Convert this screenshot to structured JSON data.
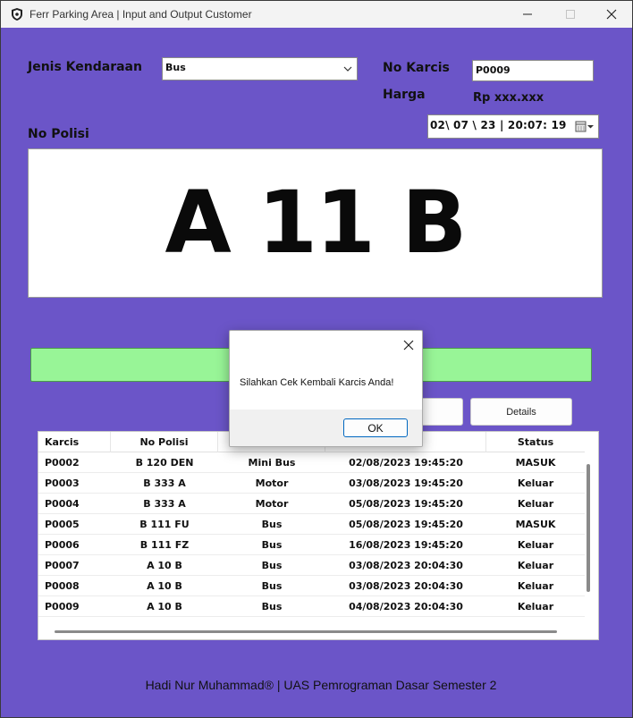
{
  "window": {
    "title": "Ferr Parking Area | Input and Output Customer",
    "icon": "shield-icon",
    "controls": {
      "minimize": "minimize-icon",
      "maximize": "maximize-icon",
      "close": "close-icon"
    }
  },
  "form": {
    "jenis_kendaraan_label": "Jenis Kendaraan",
    "jenis_kendaraan_value": "Bus",
    "no_karcis_label": "No Karcis",
    "no_karcis_value": "P0009",
    "harga_label": "Harga",
    "harga_value": "Rp xxx.xxx",
    "no_polisi_label": "No Polisi",
    "datetime_value": "02\\ 07 \\ 23 | 20:07: 19"
  },
  "plate": {
    "text": "A 11 B"
  },
  "buttons": {
    "details": "Details"
  },
  "table": {
    "headers": [
      "Karcis",
      "No Polisi",
      "",
      "",
      "Status"
    ],
    "rows": [
      [
        "P0002",
        "B 120 DEN",
        "Mini Bus",
        "02/08/2023 19:45:20",
        "MASUK"
      ],
      [
        "P0003",
        "B 333 A",
        "Motor",
        "03/08/2023 19:45:20",
        "Keluar"
      ],
      [
        "P0004",
        "B 333 A",
        "Motor",
        "05/08/2023 19:45:20",
        "Keluar"
      ],
      [
        "P0005",
        "B 111 FU",
        "Bus",
        "05/08/2023 19:45:20",
        "MASUK"
      ],
      [
        "P0006",
        "B 111 FZ",
        "Bus",
        "16/08/2023 19:45:20",
        "Keluar"
      ],
      [
        "P0007",
        "A 10 B",
        "Bus",
        "03/08/2023 20:04:30",
        "Keluar"
      ],
      [
        "P0008",
        "A 10 B",
        "Bus",
        "03/08/2023 20:04:30",
        "Keluar"
      ],
      [
        "P0009",
        "A 10 B",
        "Bus",
        "04/08/2023 20:04:30",
        "Keluar"
      ]
    ]
  },
  "footer": {
    "text": "Hadi Nur Muhammad® | UAS Pemrograman Dasar Semester 2"
  },
  "dialog": {
    "message": "Silahkan Cek Kembali Karcis Anda!",
    "ok_label": "OK"
  },
  "colors": {
    "background": "#6b55c8",
    "status_bar": "#98f597",
    "accent": "#0067c0"
  }
}
